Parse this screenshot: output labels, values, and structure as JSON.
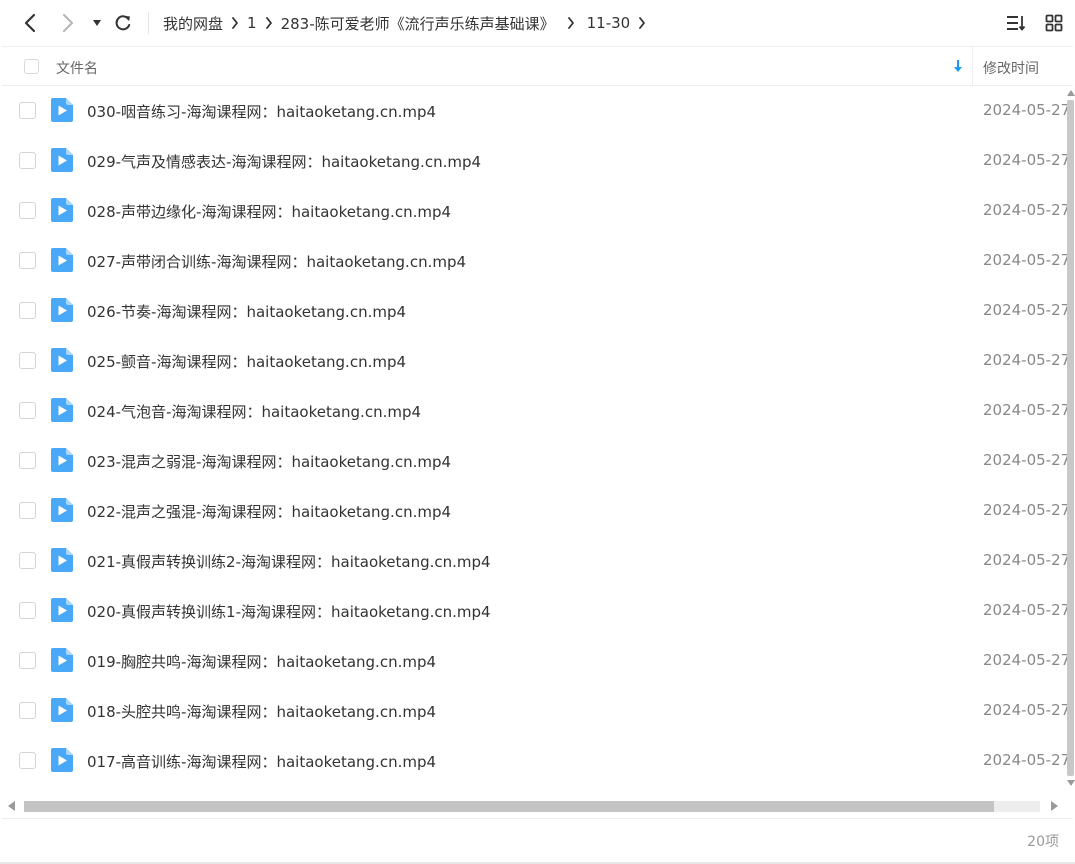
{
  "breadcrumb": [
    "我的网盘",
    "1",
    "283-陈可爱老师《流行声乐练声基础课》",
    "11-30"
  ],
  "header": {
    "name": "文件名",
    "modified": "修改时间"
  },
  "files": [
    {
      "name": "030-咽音练习-海淘课程网：haitaoketang.cn.mp4",
      "time": "2024-05-27"
    },
    {
      "name": "029-气声及情感表达-海淘课程网：haitaoketang.cn.mp4",
      "time": "2024-05-27"
    },
    {
      "name": "028-声带边缘化-海淘课程网：haitaoketang.cn.mp4",
      "time": "2024-05-27"
    },
    {
      "name": "027-声带闭合训练-海淘课程网：haitaoketang.cn.mp4",
      "time": "2024-05-27"
    },
    {
      "name": "026-节奏-海淘课程网：haitaoketang.cn.mp4",
      "time": "2024-05-27"
    },
    {
      "name": "025-颤音-海淘课程网：haitaoketang.cn.mp4",
      "time": "2024-05-27"
    },
    {
      "name": "024-气泡音-海淘课程网：haitaoketang.cn.mp4",
      "time": "2024-05-27"
    },
    {
      "name": "023-混声之弱混-海淘课程网：haitaoketang.cn.mp4",
      "time": "2024-05-27"
    },
    {
      "name": "022-混声之强混-海淘课程网：haitaoketang.cn.mp4",
      "time": "2024-05-27"
    },
    {
      "name": "021-真假声转换训练2-海淘课程网：haitaoketang.cn.mp4",
      "time": "2024-05-27"
    },
    {
      "name": "020-真假声转换训练1-海淘课程网：haitaoketang.cn.mp4",
      "time": "2024-05-27"
    },
    {
      "name": "019-胸腔共鸣-海淘课程网：haitaoketang.cn.mp4",
      "time": "2024-05-27"
    },
    {
      "name": "018-头腔共鸣-海淘课程网：haitaoketang.cn.mp4",
      "time": "2024-05-27"
    },
    {
      "name": "017-高音训练-海淘课程网：haitaoketang.cn.mp4",
      "time": "2024-05-27"
    }
  ],
  "footer": {
    "count": "20项"
  },
  "icons": {
    "back": "arrow-left-icon",
    "forward": "arrow-right-icon",
    "history": "dropdown-caret-icon",
    "refresh": "refresh-icon",
    "sort": "sort-list-icon",
    "grid": "grid-view-icon",
    "file": "video-file-icon"
  },
  "colors": {
    "accent": "#1e9bf0",
    "file_icon": "#4aa8f8"
  }
}
